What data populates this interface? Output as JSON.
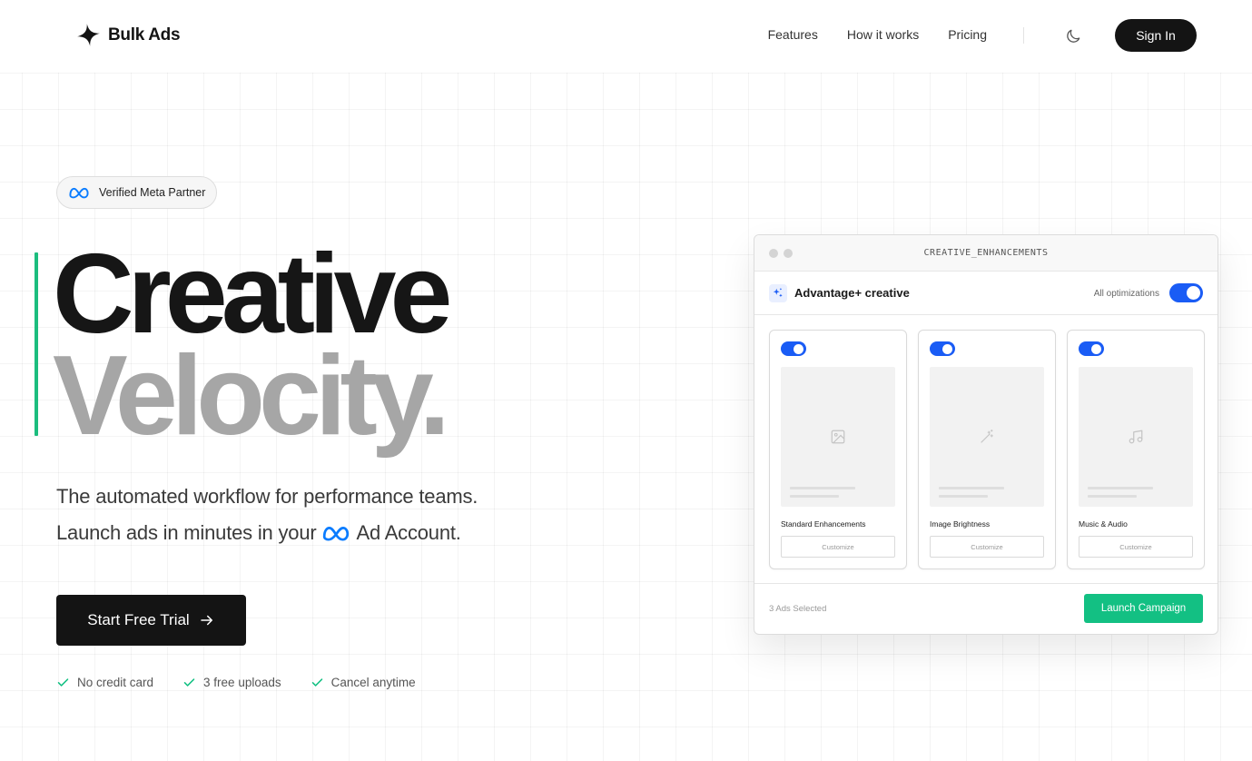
{
  "brand": {
    "name": "Bulk Ads"
  },
  "nav": {
    "items": [
      {
        "label": "Features"
      },
      {
        "label": "How it works"
      },
      {
        "label": "Pricing"
      }
    ],
    "signin_label": "Sign In"
  },
  "hero": {
    "badge_label": "Verified Meta Partner",
    "headline_line1": "Creative",
    "headline_line2": "Velocity.",
    "subtitle_line1": "The automated workflow for performance teams.",
    "subtitle_line2_prefix": "Launch ads in minutes in your",
    "subtitle_line2_suffix": "Ad Account.",
    "cta_label": "Start Free Trial",
    "checks": [
      {
        "label": "No credit card"
      },
      {
        "label": "3 free uploads"
      },
      {
        "label": "Cancel anytime"
      }
    ]
  },
  "mockup": {
    "window_title": "CREATIVE_ENHANCEMENTS",
    "section_label": "Advantage+ creative",
    "optimizations_label": "All optimizations",
    "optimizations_enabled": true,
    "cards": [
      {
        "name": "Standard Enhancements",
        "button": "Customize",
        "icon": "image-icon",
        "enabled": true
      },
      {
        "name": "Image Brightness",
        "button": "Customize",
        "icon": "magic-wand-icon",
        "enabled": true
      },
      {
        "name": "Music & Audio",
        "button": "Customize",
        "icon": "music-icon",
        "enabled": true
      }
    ],
    "selected_text": "3 Ads Selected",
    "launch_label": "Launch Campaign"
  },
  "colors": {
    "accent_green": "#13c083",
    "toggle_blue": "#1a5cf5",
    "meta_blue": "#0a7cff",
    "dark": "#141414",
    "headline_gray": "#a6a6a6"
  }
}
